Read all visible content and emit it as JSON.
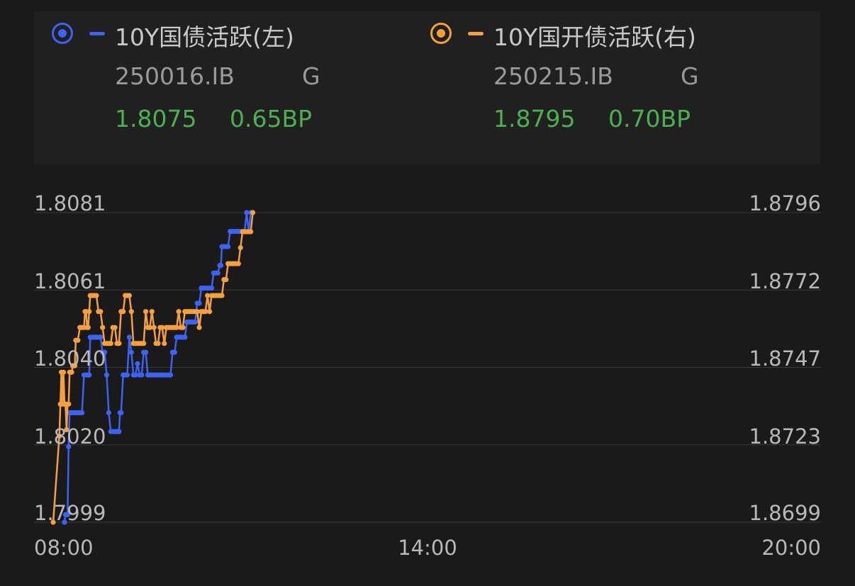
{
  "legend": [
    {
      "name": "10Y国债活跃(左)",
      "code": "250016.IB",
      "grade": "G",
      "yield": "1.8075",
      "change": "0.65BP",
      "color": "#3d63f0"
    },
    {
      "name": "10Y国开债活跃(右)",
      "code": "250215.IB",
      "grade": "G",
      "yield": "1.8795",
      "change": "0.70BP",
      "color": "#f5a03c"
    }
  ],
  "colors": {
    "background": "#1a1a1a",
    "panel": "#202020",
    "grid": "#3a3a3a",
    "axis_text": "#b8b8b8",
    "value_up": "#4caf50"
  },
  "chart_data": {
    "type": "line",
    "x_axis": {
      "ticks": [
        "08:00",
        "14:00",
        "20:00"
      ],
      "range_minutes": [
        0,
        720
      ]
    },
    "y_left": {
      "ticks": [
        "1.8081",
        "1.8061",
        "1.8040",
        "1.8020",
        "1.7999"
      ],
      "range": [
        1.7999,
        1.8081
      ]
    },
    "y_right": {
      "ticks": [
        "1.8796",
        "1.8772",
        "1.8747",
        "1.8723",
        "1.8699"
      ],
      "range": [
        1.8699,
        1.8796
      ]
    },
    "grid": true,
    "series": [
      {
        "name": "10Y国债活跃(左)",
        "axis": "left",
        "color": "#3d63f0",
        "minutes": [
          11,
          11,
          12,
          13,
          14,
          15,
          16,
          18,
          20,
          22,
          24,
          26,
          28,
          30,
          32,
          34,
          35,
          36,
          38,
          40,
          42,
          44,
          46,
          48,
          50,
          52,
          54,
          56,
          58,
          60,
          62,
          64,
          65,
          66,
          68,
          69,
          70,
          72,
          74,
          76,
          78,
          80,
          82,
          84,
          86,
          88,
          90,
          92,
          94,
          96,
          98,
          100,
          102,
          104,
          106,
          108,
          110,
          112,
          114,
          116,
          118,
          120,
          122,
          124,
          126,
          128,
          130,
          132,
          134,
          136,
          138,
          140,
          142,
          144,
          146,
          148,
          150,
          152,
          154,
          156,
          158,
          160,
          162,
          163,
          164,
          166,
          168,
          170,
          172,
          174,
          176,
          178,
          180,
          182,
          184,
          186,
          188,
          190,
          192
        ],
        "values": [
          1.7999,
          1.7999,
          1.8001,
          1.8001,
          1.8001,
          1.8019,
          1.8028,
          1.8028,
          1.8028,
          1.8028,
          1.8028,
          1.8028,
          1.8028,
          1.8038,
          1.8038,
          1.8038,
          1.8038,
          1.8048,
          1.8048,
          1.8048,
          1.8048,
          1.8048,
          1.8048,
          1.8044,
          1.8044,
          1.8038,
          1.8028,
          1.8023,
          1.8023,
          1.8023,
          1.8023,
          1.8023,
          1.8028,
          1.8028,
          1.8038,
          1.8038,
          1.8038,
          1.8038,
          1.8048,
          1.8044,
          1.8038,
          1.8038,
          1.8041,
          1.8038,
          1.8038,
          1.8044,
          1.8044,
          1.8038,
          1.8038,
          1.8038,
          1.8038,
          1.8038,
          1.8038,
          1.8038,
          1.8038,
          1.8038,
          1.8038,
          1.8038,
          1.8038,
          1.8044,
          1.8044,
          1.8048,
          1.8048,
          1.8048,
          1.8048,
          1.8048,
          1.8052,
          1.8052,
          1.8052,
          1.8052,
          1.8052,
          1.8057,
          1.8057,
          1.8061,
          1.8061,
          1.8061,
          1.8061,
          1.8061,
          1.8061,
          1.8065,
          1.8065,
          1.8065,
          1.8067,
          1.8067,
          1.8072,
          1.8072,
          1.8072,
          1.8072,
          1.8076,
          1.8076,
          1.8076,
          1.8076,
          1.8076,
          1.8076,
          1.8076,
          1.8076,
          1.8081,
          1.8076,
          1.8081
        ]
      },
      {
        "name": "10Y国开债活跃(右)",
        "axis": "right",
        "color": "#f5a03c",
        "minutes": [
          0,
          6,
          7,
          8,
          9,
          10,
          11,
          12,
          13,
          14,
          15,
          16,
          17,
          18,
          19,
          20,
          21,
          22,
          24,
          26,
          27,
          28,
          30,
          31,
          32,
          33,
          34,
          35,
          36,
          38,
          40,
          42,
          44,
          46,
          48,
          50,
          52,
          54,
          56,
          58,
          60,
          62,
          64,
          66,
          68,
          70,
          72,
          74,
          76,
          78,
          80,
          82,
          84,
          86,
          88,
          90,
          92,
          94,
          96,
          98,
          100,
          102,
          104,
          106,
          108,
          110,
          112,
          114,
          116,
          118,
          120,
          122,
          124,
          126,
          128,
          130,
          132,
          134,
          136,
          138,
          140,
          142,
          144,
          146,
          148,
          150,
          152,
          154,
          156,
          158,
          160,
          162,
          164,
          166,
          168,
          170,
          172,
          174,
          176,
          178,
          180,
          182,
          184,
          186,
          188,
          190,
          192,
          194
        ],
        "values": [
          1.8699,
          1.8726,
          1.8736,
          1.8746,
          1.8736,
          1.8746,
          1.8736,
          1.8736,
          1.8728,
          1.8736,
          1.8736,
          1.8746,
          1.8746,
          1.8746,
          1.8748,
          1.8748,
          1.8748,
          1.8756,
          1.8756,
          1.876,
          1.876,
          1.876,
          1.876,
          1.8765,
          1.8765,
          1.876,
          1.876,
          1.8765,
          1.877,
          1.877,
          1.877,
          1.877,
          1.8765,
          1.8765,
          1.876,
          1.8755,
          1.8755,
          1.8755,
          1.8755,
          1.876,
          1.876,
          1.8755,
          1.8755,
          1.8765,
          1.8765,
          1.877,
          1.877,
          1.877,
          1.8765,
          1.8755,
          1.8755,
          1.8755,
          1.8755,
          1.8755,
          1.8755,
          1.8765,
          1.876,
          1.876,
          1.8765,
          1.876,
          1.8755,
          1.8755,
          1.876,
          1.876,
          1.8755,
          1.876,
          1.876,
          1.876,
          1.876,
          1.876,
          1.876,
          1.8765,
          1.876,
          1.876,
          1.8765,
          1.8765,
          1.8765,
          1.8765,
          1.8765,
          1.8765,
          1.8765,
          1.876,
          1.8765,
          1.8765,
          1.8765,
          1.877,
          1.8765,
          1.877,
          1.877,
          1.877,
          1.877,
          1.877,
          1.877,
          1.8775,
          1.8775,
          1.878,
          1.878,
          1.878,
          1.878,
          1.878,
          1.878,
          1.8785,
          1.879,
          1.879,
          1.879,
          1.879,
          1.879,
          1.8796
        ]
      }
    ]
  }
}
